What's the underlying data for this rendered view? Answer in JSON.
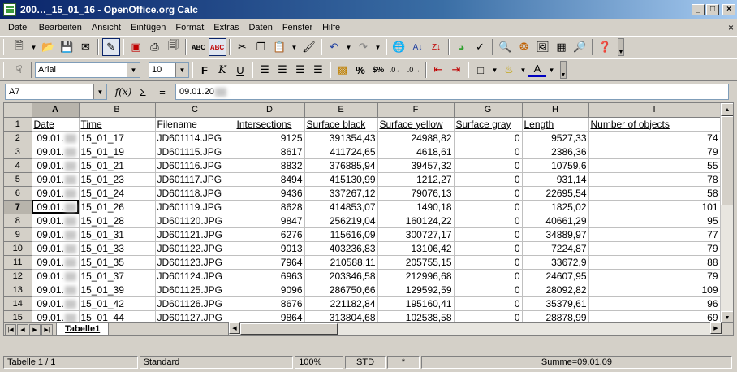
{
  "window": {
    "title": "200…_15_01_16 - OpenOffice.org Calc",
    "buttons": {
      "minimize": "_",
      "maximize": "□",
      "close": "×"
    }
  },
  "menu": {
    "items": [
      "Datei",
      "Bearbeiten",
      "Ansicht",
      "Einfügen",
      "Format",
      "Extras",
      "Daten",
      "Fenster",
      "Hilfe"
    ],
    "close_doc": "×"
  },
  "toolbar": {
    "icons": [
      "new-icon",
      "open-icon",
      "save-icon",
      "email-icon",
      "edit-file-icon",
      "pdf-icon",
      "print-icon",
      "page-preview-icon",
      "spellcheck-icon",
      "autospellcheck-icon",
      "cut-icon",
      "copy-icon",
      "paste-icon",
      "format-paintbrush-icon",
      "undo-icon",
      "redo-icon",
      "hyperlink-icon",
      "sort-ascending-icon",
      "sort-descending-icon",
      "chart-icon",
      "show-draw-icon",
      "find-icon",
      "navigator-icon",
      "gallery-icon",
      "datasources-icon",
      "zoom-icon",
      "help-icon"
    ]
  },
  "format_toolbar": {
    "font_name": "Arial",
    "font_size": "10",
    "bold": "F",
    "italic": "K",
    "underline": "U",
    "percent": "%",
    "currency": "$%",
    "accent_color": "#0a246a"
  },
  "formula_bar": {
    "name_box": "A7",
    "fx": "f(x)",
    "sigma": "Σ",
    "equals": "=",
    "content": "09.01.20"
  },
  "sheet": {
    "column_headers": [
      "A",
      "B",
      "C",
      "D",
      "E",
      "F",
      "G",
      "H",
      "I",
      "J"
    ],
    "header_row": [
      "Date",
      "Time",
      "Filename",
      "Intersections",
      "Surface black",
      "Surface yellow",
      "Surface gray",
      "Length",
      "Number of objects"
    ],
    "rows": [
      {
        "n": "2",
        "date": "09.01.",
        "time": "15_01_17",
        "file": "JD601114.JPG",
        "inter": "9125",
        "black": "391354,43",
        "yellow": "24988,82",
        "gray": "0",
        "length": "9527,33",
        "objects": "74"
      },
      {
        "n": "3",
        "date": "09.01.",
        "time": "15_01_19",
        "file": "JD601115.JPG",
        "inter": "8617",
        "black": "411724,65",
        "yellow": "4618,61",
        "gray": "0",
        "length": "2386,36",
        "objects": "79"
      },
      {
        "n": "4",
        "date": "09.01.",
        "time": "15_01_21",
        "file": "JD601116.JPG",
        "inter": "8832",
        "black": "376885,94",
        "yellow": "39457,32",
        "gray": "0",
        "length": "10759,6",
        "objects": "55"
      },
      {
        "n": "5",
        "date": "09.01.",
        "time": "15_01_23",
        "file": "JD601117.JPG",
        "inter": "8494",
        "black": "415130,99",
        "yellow": "1212,27",
        "gray": "0",
        "length": "931,14",
        "objects": "78"
      },
      {
        "n": "6",
        "date": "09.01.",
        "time": "15_01_24",
        "file": "JD601118.JPG",
        "inter": "9436",
        "black": "337267,12",
        "yellow": "79076,13",
        "gray": "0",
        "length": "22695,54",
        "objects": "58"
      },
      {
        "n": "7",
        "date": "09.01.",
        "time": "15_01_26",
        "file": "JD601119.JPG",
        "inter": "8628",
        "black": "414853,07",
        "yellow": "1490,18",
        "gray": "0",
        "length": "1825,02",
        "objects": "101"
      },
      {
        "n": "8",
        "date": "09.01.",
        "time": "15_01_28",
        "file": "JD601120.JPG",
        "inter": "9847",
        "black": "256219,04",
        "yellow": "160124,22",
        "gray": "0",
        "length": "40661,29",
        "objects": "95"
      },
      {
        "n": "9",
        "date": "09.01.",
        "time": "15_01_31",
        "file": "JD601121.JPG",
        "inter": "6276",
        "black": "115616,09",
        "yellow": "300727,17",
        "gray": "0",
        "length": "34889,97",
        "objects": "77"
      },
      {
        "n": "10",
        "date": "09.01.",
        "time": "15_01_33",
        "file": "JD601122.JPG",
        "inter": "9013",
        "black": "403236,83",
        "yellow": "13106,42",
        "gray": "0",
        "length": "7224,87",
        "objects": "79"
      },
      {
        "n": "11",
        "date": "09.01.",
        "time": "15_01_35",
        "file": "JD601123.JPG",
        "inter": "7964",
        "black": "210588,11",
        "yellow": "205755,15",
        "gray": "0",
        "length": "33672,9",
        "objects": "88"
      },
      {
        "n": "12",
        "date": "09.01.",
        "time": "15_01_37",
        "file": "JD601124.JPG",
        "inter": "6963",
        "black": "203346,58",
        "yellow": "212996,68",
        "gray": "0",
        "length": "24607,95",
        "objects": "79"
      },
      {
        "n": "13",
        "date": "09.01.",
        "time": "15_01_39",
        "file": "JD601125.JPG",
        "inter": "9096",
        "black": "286750,66",
        "yellow": "129592,59",
        "gray": "0",
        "length": "28092,82",
        "objects": "109"
      },
      {
        "n": "14",
        "date": "09.01.",
        "time": "15_01_42",
        "file": "JD601126.JPG",
        "inter": "8676",
        "black": "221182,84",
        "yellow": "195160,41",
        "gray": "0",
        "length": "35379,61",
        "objects": "96"
      },
      {
        "n": "15",
        "date": "09.01.",
        "time": "15_01_44",
        "file": "JD601127.JPG",
        "inter": "9864",
        "black": "313804,68",
        "yellow": "102538,58",
        "gray": "0",
        "length": "28878,99",
        "objects": "69"
      }
    ],
    "empty_row": "16",
    "tab_name": "Tabelle1"
  },
  "status": {
    "sheet": "Tabelle 1 / 1",
    "style": "Standard",
    "zoom": "100%",
    "mode": "STD",
    "modified": "*",
    "sum": "Summe=09.01.09"
  }
}
